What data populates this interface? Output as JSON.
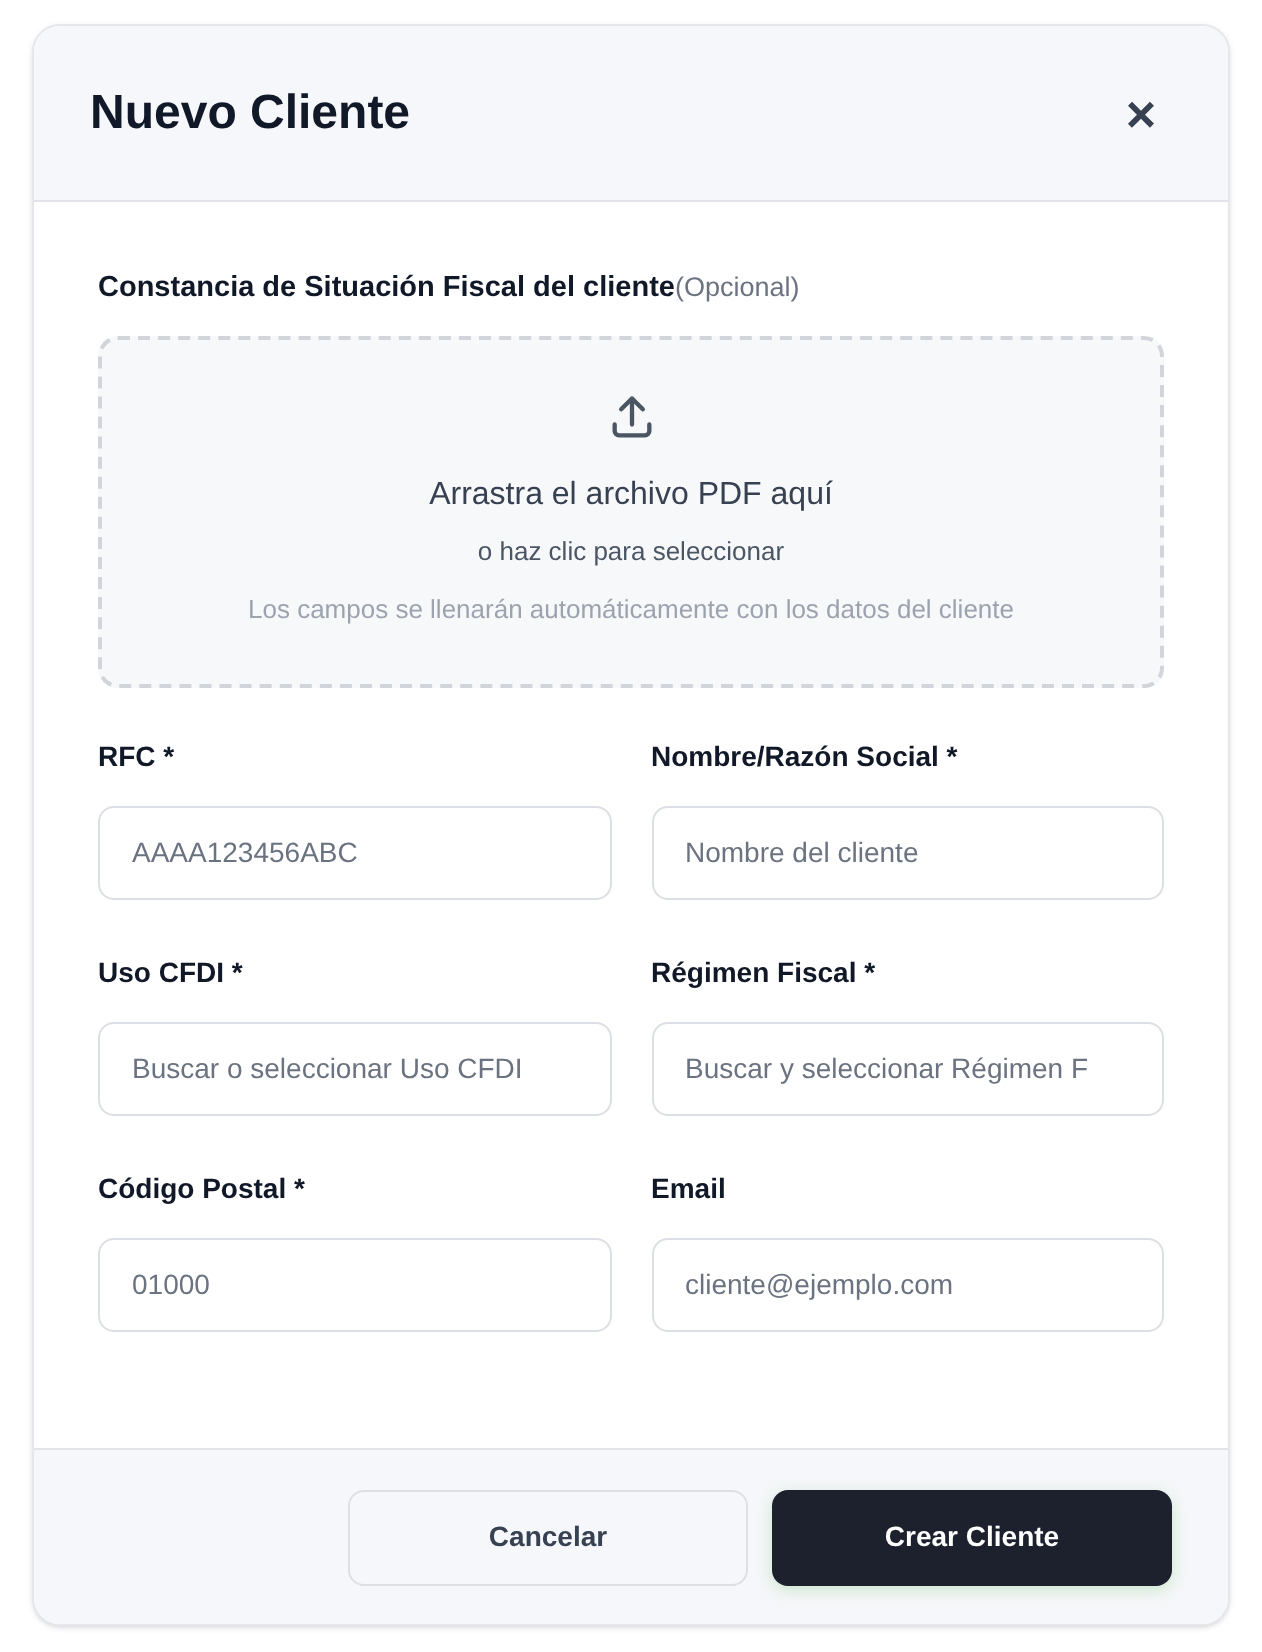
{
  "dialog": {
    "title": "Nuevo Cliente",
    "close_icon": "×"
  },
  "upload": {
    "label": "Constancia de Situación Fiscal del cliente",
    "optional": "(Opcional)",
    "title": "Arrastra el archivo PDF aquí",
    "subtitle": "o haz clic para seleccionar",
    "hint": "Los campos se llenarán automáticamente con los datos del cliente"
  },
  "fields": [
    {
      "label": "RFC *",
      "placeholder": "AAAA123456ABC"
    },
    {
      "label": "Nombre/Razón Social *",
      "placeholder": "Nombre del cliente"
    },
    {
      "label": "Uso CFDI *",
      "placeholder": "Buscar o seleccionar Uso CFDI"
    },
    {
      "label": "Régimen Fiscal *",
      "placeholder": "Buscar y seleccionar Régimen F"
    },
    {
      "label": "Código Postal *",
      "placeholder": "01000"
    },
    {
      "label": "Email",
      "placeholder": "cliente@ejemplo.com"
    }
  ],
  "buttons": [
    {
      "label": "Cancelar",
      "kind": "secondary"
    },
    {
      "label": "Crear Cliente",
      "kind": "primary"
    }
  ]
}
